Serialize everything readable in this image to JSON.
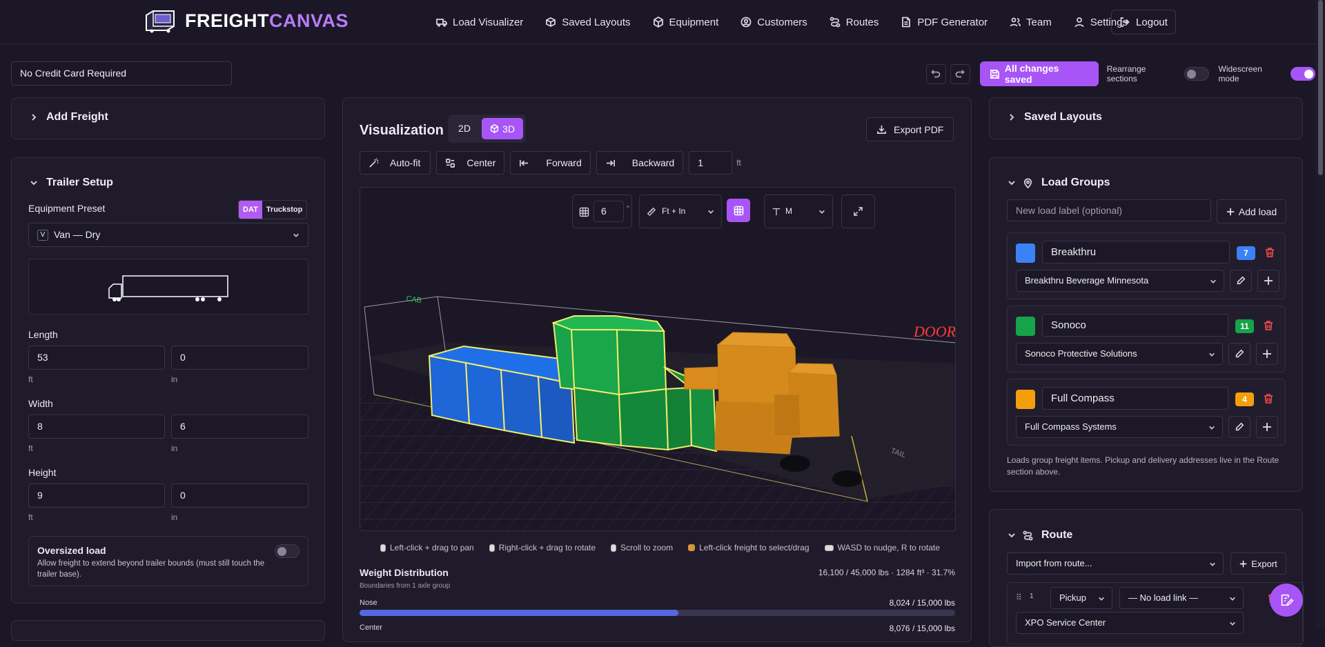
{
  "brand": {
    "name_part1": "FREIGHT",
    "name_part2": "CANVAS"
  },
  "nav": {
    "items": [
      {
        "label": "Load Visualizer",
        "icon": "truck-icon"
      },
      {
        "label": "Saved Layouts",
        "icon": "box-icon"
      },
      {
        "label": "Equipment",
        "icon": "cube-icon"
      },
      {
        "label": "Customers",
        "icon": "user-circle-icon"
      },
      {
        "label": "Routes",
        "icon": "route-icon"
      },
      {
        "label": "PDF Generator",
        "icon": "file-icon"
      },
      {
        "label": "Team",
        "icon": "users-icon"
      },
      {
        "label": "Settings",
        "icon": "user-icon"
      }
    ],
    "logout": "Logout"
  },
  "project_name": "No Credit Card Required",
  "toolbar": {
    "saved_label": "All changes saved",
    "rearrange_label": "Rearrange sections",
    "rearrange_on": false,
    "widescreen_label": "Widescreen mode",
    "widescreen_on": true
  },
  "add_freight": {
    "title": "Add Freight"
  },
  "trailer_setup": {
    "title": "Trailer Setup",
    "preset_label": "Equipment Preset",
    "preset_sources": [
      "DAT",
      "Truckstop"
    ],
    "preset_source_selected": "DAT",
    "preset_badge": "V",
    "preset_value": "Van — Dry",
    "length": {
      "label": "Length",
      "ft": "53",
      "in": "0"
    },
    "width": {
      "label": "Width",
      "ft": "8",
      "in": "6"
    },
    "height": {
      "label": "Height",
      "ft": "9",
      "in": "0"
    },
    "unit_ft": "ft",
    "unit_in": "in",
    "oversized_title": "Oversized load",
    "oversized_desc": "Allow freight to extend beyond trailer bounds (must still touch the trailer base).",
    "oversized_on": false
  },
  "visualization": {
    "title": "Visualization",
    "modes": [
      "2D",
      "3D"
    ],
    "mode_selected": "3D",
    "export_label": "Export PDF",
    "autofit": "Auto-fit",
    "center": "Center",
    "forward": "Forward",
    "backward": "Backward",
    "step_value": "1",
    "step_unit": "ft",
    "grid_value": "6",
    "grid_unit": "\"",
    "units_select": "Ft + In",
    "text_size": "M",
    "scene_labels": {
      "cab": "CAB",
      "door": "DOOR",
      "tail": "TAIL"
    },
    "hints": [
      "Left-click + drag to pan",
      "Right-click + drag to rotate",
      "Scroll to zoom",
      "Left-click freight to select/drag",
      "WASD to nudge, R to rotate"
    ]
  },
  "weight": {
    "title": "Weight Distribution",
    "subtitle": "Boundaries from 1 axle group",
    "summary": "16,100 / 45,000 lbs · 1284 ft³ · 31.7%",
    "rows": [
      {
        "label": "Nose",
        "value": "8,024 / 15,000 lbs",
        "fraction": 0.535
      },
      {
        "label": "Center",
        "value": "8,076 / 15,000 lbs",
        "fraction": 0.538
      }
    ]
  },
  "saved_layouts": {
    "title": "Saved Layouts"
  },
  "load_groups": {
    "title": "Load Groups",
    "new_placeholder": "New load label (optional)",
    "add_label": "Add load",
    "groups": [
      {
        "name": "Breakthru",
        "count": "7",
        "color": "#3b82f6",
        "count_color": "#3b82f6",
        "customer": "Breakthru Beverage Minnesota"
      },
      {
        "name": "Sonoco",
        "count": "11",
        "color": "#16a34a",
        "count_color": "#16a34a",
        "customer": "Sonoco Protective Solutions"
      },
      {
        "name": "Full Compass",
        "count": "4",
        "color": "#f59e0b",
        "count_color": "#f59e0b",
        "customer": "Full Compass Systems"
      }
    ],
    "note": "Loads group freight items. Pickup and delivery addresses live in the Route section above."
  },
  "route": {
    "title": "Route",
    "import_label": "Import from route...",
    "export_label": "Export",
    "stop_index": "1",
    "stop_type": "Pickup",
    "load_link": "— No load link —",
    "location": "XPO Service Center"
  }
}
